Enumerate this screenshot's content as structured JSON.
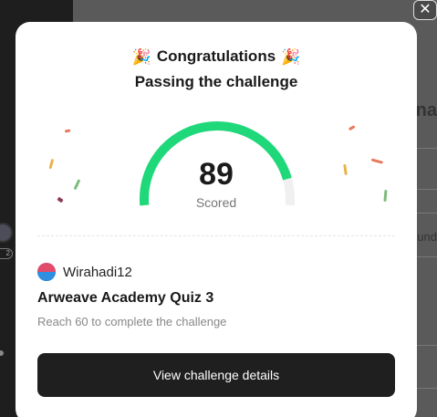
{
  "background": {
    "right_heading": "na",
    "right_text": "und",
    "badge_text": "2"
  },
  "modal": {
    "title": "Congratulations",
    "title_icon": "party-popper-icon",
    "subtitle": "Passing the challenge",
    "score": "89",
    "score_label": "Scored",
    "score_fraction": 0.89,
    "colors": {
      "gauge_fill": "#1ed87a",
      "gauge_track": "#f0f0f0",
      "button_bg": "#1f1f1f"
    },
    "user": {
      "name": "Wirahadi12"
    },
    "quiz_title": "Arweave Academy Quiz 3",
    "quiz_desc": "Reach 60 to complete the challenge",
    "cta_label": "View challenge details"
  }
}
